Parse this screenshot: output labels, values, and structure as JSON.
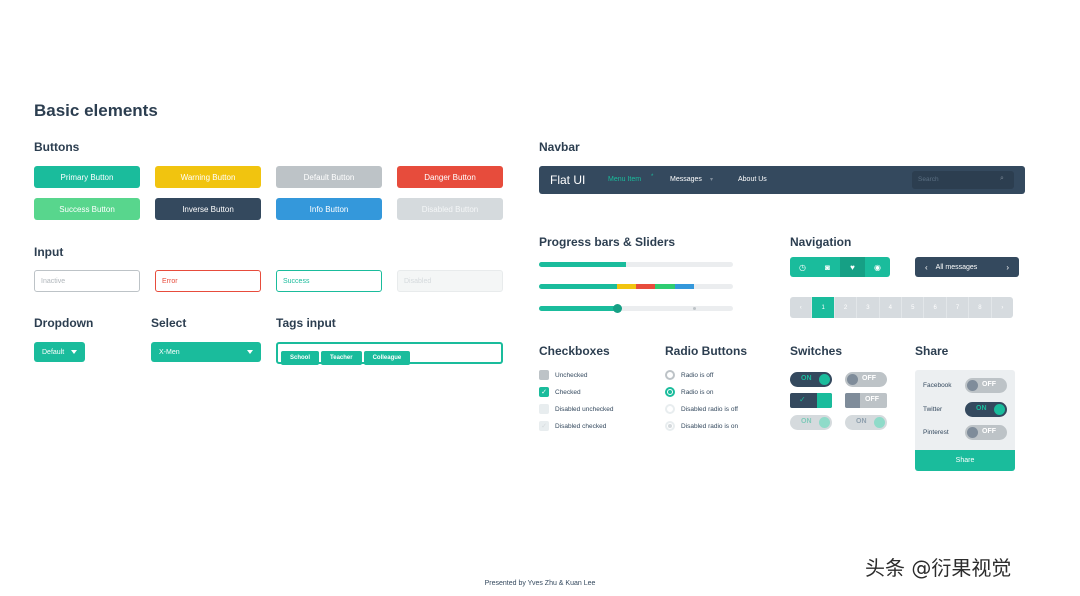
{
  "page_title": "Basic elements",
  "buttons": {
    "heading": "Buttons",
    "row1": [
      {
        "label": "Primary Button",
        "color": "#1abc9c"
      },
      {
        "label": "Warning Button",
        "color": "#f1c40f"
      },
      {
        "label": "Default Button",
        "color": "#bdc3c7"
      },
      {
        "label": "Danger Button",
        "color": "#e74c3c"
      }
    ],
    "row2": [
      {
        "label": "Success Button",
        "color": "#58d68d"
      },
      {
        "label": "Inverse Button",
        "color": "#34495e"
      },
      {
        "label": "Info Button",
        "color": "#3498db"
      },
      {
        "label": "Disabled Button",
        "color": "#d5dadd"
      }
    ]
  },
  "input": {
    "heading": "Input",
    "fields": [
      {
        "placeholder": "Inactive"
      },
      {
        "placeholder": "Error"
      },
      {
        "placeholder": "Success"
      },
      {
        "placeholder": "Disabled"
      }
    ]
  },
  "dropdown": {
    "heading": "Dropdown",
    "value": "Default"
  },
  "select": {
    "heading": "Select",
    "value": "X-Men"
  },
  "tags_input": {
    "heading": "Tags input",
    "tags": [
      "School",
      "Teacher",
      "Colleague"
    ]
  },
  "navbar": {
    "heading": "Navbar",
    "brand": "Flat UI",
    "items": [
      "Menu Item",
      "Messages",
      "About Us"
    ],
    "search_placeholder": "Search"
  },
  "progress": {
    "heading": "Progress bars & Sliders",
    "bar1_fraction": 0.45,
    "bar2_segments": [
      {
        "fraction": 0.4,
        "color": "#1abc9c"
      },
      {
        "fraction": 0.1,
        "color": "#f1c40f"
      },
      {
        "fraction": 0.1,
        "color": "#e74c3c"
      },
      {
        "fraction": 0.1,
        "color": "#2ecc71"
      },
      {
        "fraction": 0.1,
        "color": "#3498db"
      }
    ],
    "slider_fraction": 0.4
  },
  "navigation": {
    "heading": "Navigation",
    "icons": [
      "clock-icon",
      "camera-icon",
      "heart-icon",
      "eye-icon"
    ],
    "messages_label": "All messages",
    "pages": [
      "1",
      "2",
      "3",
      "4",
      "5",
      "6",
      "7",
      "8"
    ],
    "active_page": "1"
  },
  "checkboxes": {
    "heading": "Checkboxes",
    "items": [
      "Unchecked",
      "Checked",
      "Disabled unchecked",
      "Disabled checked"
    ]
  },
  "radios": {
    "heading": "Radio Buttons",
    "items": [
      "Radio is off",
      "Radio is on",
      "Disabled radio is off",
      "Disabled radio is on"
    ]
  },
  "switches": {
    "heading": "Switches",
    "on_label": "ON",
    "off_label": "OFF"
  },
  "share": {
    "heading": "Share",
    "items": [
      {
        "label": "Facebook",
        "state": "OFF"
      },
      {
        "label": "Twitter",
        "state": "ON"
      },
      {
        "label": "Pinterest",
        "state": "OFF"
      }
    ],
    "button_label": "Share"
  },
  "footer": "Presented by Yves Zhu & Kuan Lee",
  "watermark": "头条 @衍果视觉"
}
